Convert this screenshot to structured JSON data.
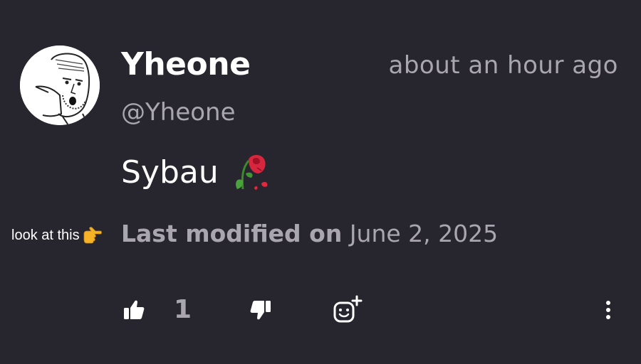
{
  "comment": {
    "author_name": "Yheone",
    "author_handle": "@Yheone",
    "timestamp": "about an hour ago",
    "body": "Sybau",
    "body_emoji": "wilted-rose-icon",
    "modified_label": "Last modified on",
    "modified_date": "June 2, 2025",
    "likes": "1"
  },
  "annotation": {
    "text": "look at this",
    "icon": "pointing-right-icon"
  },
  "actions": {
    "like_icon": "thumbs-up-icon",
    "dislike_icon": "thumbs-down-icon",
    "react_icon": "add-reaction-icon",
    "more_icon": "more-vertical-icon"
  },
  "colors": {
    "background": "#27252d",
    "primary_text": "#ffffff",
    "secondary_text": "#a9a6b0"
  }
}
